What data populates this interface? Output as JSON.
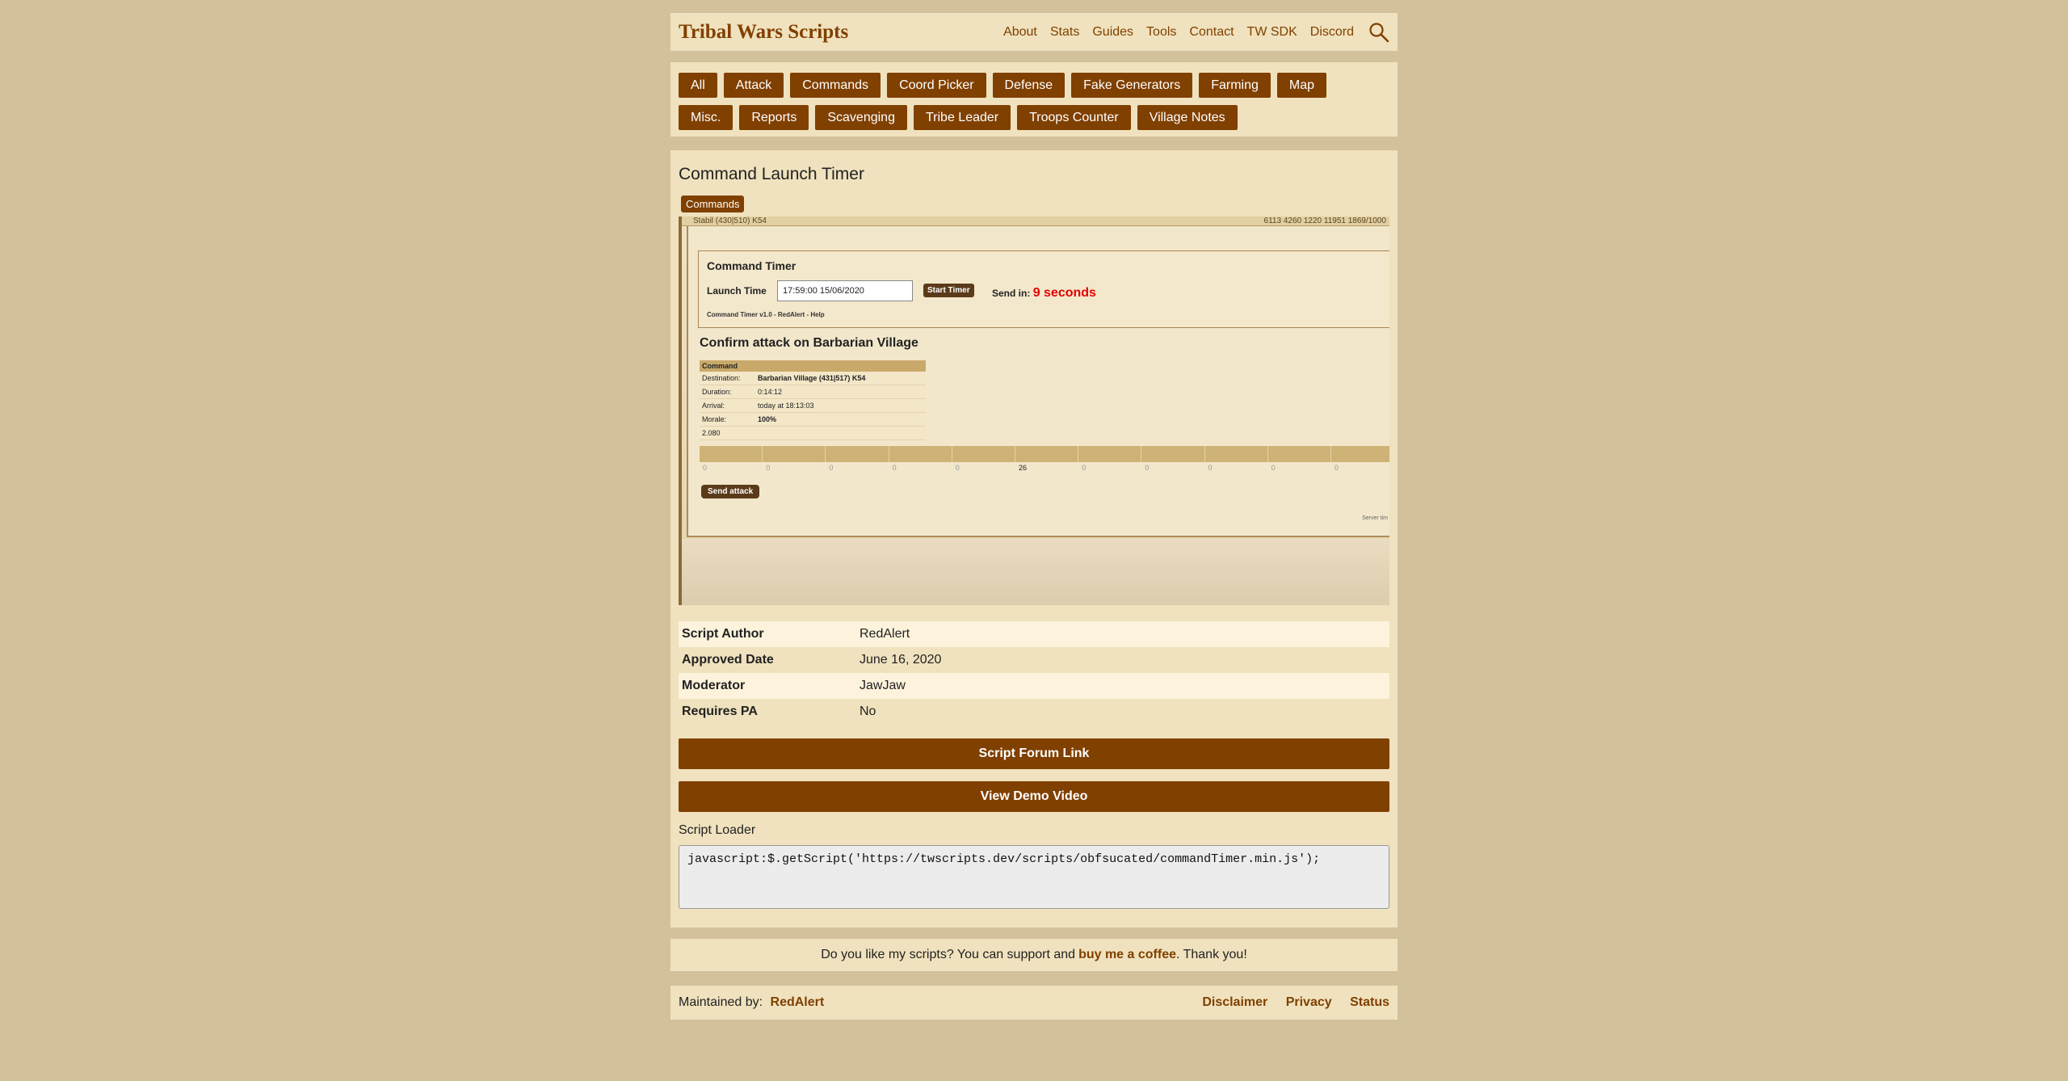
{
  "header": {
    "title": "Tribal Wars Scripts",
    "nav": [
      "About",
      "Stats",
      "Guides",
      "Tools",
      "Contact",
      "TW SDK",
      "Discord"
    ]
  },
  "categories": [
    "All",
    "Attack",
    "Commands",
    "Coord Picker",
    "Defense",
    "Fake Generators",
    "Farming",
    "Map",
    "Misc.",
    "Reports",
    "Scavenging",
    "Tribe Leader",
    "Troops Counter",
    "Village Notes"
  ],
  "script": {
    "title": "Command Launch Timer",
    "tag": "Commands",
    "screenshot": {
      "village_strip": "Stabil (430|510) K54",
      "resources": "6113  4260  1220  11951  1869/1000",
      "timer_title": "Command Timer",
      "launch_label": "Launch Time",
      "launch_value": "17:59:00 15/06/2020",
      "start_button": "Start Timer",
      "send_in_label": "Send in:",
      "send_in_value": "9 seconds",
      "version_line": "Command Timer v1.0 - RedAlert - Help",
      "confirm_heading": "Confirm attack on Barbarian Village",
      "command_header": "Command",
      "rows": [
        {
          "k": "Destination:",
          "v": "Barbarian Village (431|517) K54"
        },
        {
          "k": "Duration:",
          "v": "0:14:12"
        },
        {
          "k": "Arrival:",
          "v": "today at 18:13:03"
        },
        {
          "k": "Morale:",
          "v": "100%"
        }
      ],
      "haul": "2.080",
      "unit_values": [
        "0",
        "0",
        "0",
        "0",
        "0",
        "26",
        "0",
        "0",
        "0",
        "0",
        "0"
      ],
      "send_button": "Send attack",
      "server_time": "Server tim"
    },
    "info": [
      {
        "k": "Script Author",
        "v": "RedAlert"
      },
      {
        "k": "Approved Date",
        "v": "June 16, 2020"
      },
      {
        "k": "Moderator",
        "v": "JawJaw"
      },
      {
        "k": "Requires PA",
        "v": "No"
      }
    ],
    "forum_button": "Script Forum Link",
    "demo_button": "View Demo Video",
    "loader_label": "Script Loader",
    "loader_code": "javascript:$.getScript('https://twscripts.dev/scripts/obfsucated/commandTimer.min.js');"
  },
  "support": {
    "before": "Do you like my scripts? You can support and",
    "link": "buy me a coffee",
    "after": ". Thank you!"
  },
  "footer": {
    "maintained_label": "Maintained by:",
    "maintainer": "RedAlert",
    "links": [
      "Disclaimer",
      "Privacy",
      "Status"
    ]
  },
  "colors": {
    "accent": "#804000",
    "background": "#d3c19c",
    "panel": "#f0e2be",
    "countdown": "#e30000"
  }
}
